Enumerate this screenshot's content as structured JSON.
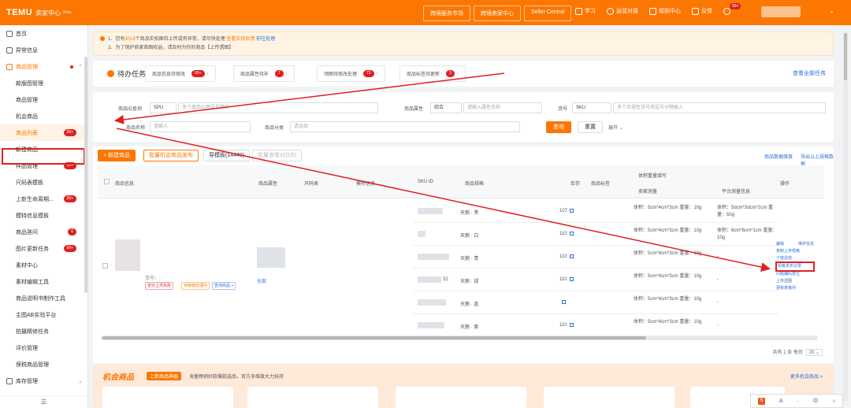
{
  "topbar": {
    "logo": "TEMU",
    "subtitle": "卖家中心",
    "beta": "Beta",
    "nav": [
      "跨境服务市场",
      "跨境卖家中心",
      "Seller Central"
    ],
    "icons": [
      {
        "label": "学习",
        "icon": "book-icon"
      },
      {
        "label": "运营对接",
        "icon": "chat-icon"
      },
      {
        "label": "规则中心",
        "icon": "rules-icon"
      },
      {
        "label": "反馈",
        "icon": "feedback-icon"
      },
      {
        "label": "",
        "icon": "bell-icon",
        "badge": "99+"
      }
    ],
    "accent": "#fb7701"
  },
  "sidebar": {
    "groups": [
      {
        "label": "首页",
        "icon": "home-icon"
      },
      {
        "label": "异常信息",
        "icon": "alert-icon"
      },
      {
        "label": "商品管理",
        "icon": "goods-icon",
        "active": true
      }
    ],
    "items": [
      {
        "label": "款版图管理"
      },
      {
        "label": "商品管理"
      },
      {
        "label": "机会商品"
      },
      {
        "label": "商品列表",
        "badge": "99+",
        "selected": true
      },
      {
        "label": "新建商品"
      },
      {
        "label": "样品管理",
        "badge": "99+"
      },
      {
        "label": "尺码表模板"
      },
      {
        "label": "上新生命周期...",
        "badge": "99+"
      },
      {
        "label": "模特信息模板"
      },
      {
        "label": "商品答问",
        "badge": "6"
      },
      {
        "label": "图片更新任务",
        "badge": "99+"
      },
      {
        "label": "素材中心"
      },
      {
        "label": "素材编辑工具"
      },
      {
        "label": "商品说明书制作工具"
      },
      {
        "label": "主图AB实验平台"
      },
      {
        "label": "拍摄精修任务"
      },
      {
        "label": "评价管理"
      },
      {
        "label": "保税商品管理"
      }
    ],
    "bottom_group": {
      "label": "库存管理",
      "icon": "warehouse-icon"
    },
    "footer": "☰"
  },
  "notice": {
    "line1_a": "1、您有",
    "line1_num": "3018",
    "line1_b": "个商品实拍图待上传或有异常，请尽快处理",
    "line1_link1": "查看实拍反馈",
    "line1_link2": "前往处理",
    "line2": "2、为了保护商家商图权益，请及时为你的商品【上传透图】"
  },
  "todo": {
    "title": "待办任务",
    "cards": [
      {
        "label": "商品信息待修改",
        "count": "99+"
      },
      {
        "label": "商品属性待补",
        "count": "7"
      },
      {
        "label": "领图待修改处理",
        "count": "73"
      },
      {
        "label": "商品标签待更新",
        "count": "3"
      }
    ],
    "all_link": "查看全部任务"
  },
  "filter": {
    "labels": [
      "商品ID查询",
      "商品属性",
      "货号",
      "商品名称",
      "商品分类"
    ],
    "spu_select": "SPU",
    "spu_placeholder": "多个商品ID用逗号隔开",
    "attr_select": "综合",
    "attr_placeholder": "请输入属性名称",
    "sku_select": "SKU",
    "sku_placeholder": "多个合规性货号用逗号分隔输入",
    "name_placeholder": "请输入",
    "cat_placeholder": "请选择",
    "query": "查询",
    "reset": "重置",
    "expand": "展开"
  },
  "toolbar": {
    "new": "+ 新建商品",
    "opp": "批量机会商品发布",
    "template": "导模板(14449)",
    "batch": "批量查看对比的",
    "link1": "商品数据维度",
    "link2": "导出以上规格数据"
  },
  "table": {
    "headers": {
      "info": "商品信息",
      "attr": "商品属性",
      "size": "尺码表",
      "model": "模特信息",
      "sku_id": "SKU ID",
      "spec": "商品规格",
      "stock": "库存",
      "label": "商品标签",
      "weight_group": "体积重量填写",
      "own": "卖家测量",
      "platform": "平台测量信息",
      "ops": "操作"
    },
    "product": {
      "status": "货号：-",
      "tags": [
        "定价上市失败",
        "待审核处理中",
        "查询商品 >"
      ],
      "attr_link": "全部"
    },
    "rows": [
      {
        "spec": "天鹅 · 黑",
        "stock": "107",
        "own": "体积：5cm*4cm*3cm  重量：10g",
        "platform": "体积：5dcm*3dcm*2cm  重量：50g"
      },
      {
        "spec": "天鹅 · 白",
        "stock": "110",
        "own": "体积：5cm*4cm*3cm  重量：10g",
        "platform": "体积：6cm*6cm*1cm  重量：10g"
      },
      {
        "spec": "天鹅 · 青",
        "stock": "110",
        "own": "体积：5cm*4cm*3cm  重量：10g",
        "platform": "-"
      },
      {
        "spec": "天鹅 · 绿",
        "stock": "110",
        "own": "体积：5cm*4cm*3cm  重量：10g",
        "platform": "-"
      },
      {
        "spec": "天鹅 · 蓝",
        "stock": "",
        "own": "体积：5cm*4cm*3cm  重量：10g",
        "platform": "-"
      },
      {
        "spec": "天鹅 · 紫",
        "stock": "110",
        "own": "体积：5cm*4cm*3cm  重量：10g",
        "platform": "-"
      }
    ],
    "row_sku_tail": [
      "",
      "",
      "",
      "32",
      "",
      ""
    ],
    "ops": [
      "编辑",
      "维护信息",
      "复制上传规格",
      "个度总结",
      "规格发布记录",
      "问题编码复位",
      "上传透图",
      "更新表格列"
    ],
    "ops_highlight": "规格发布记录"
  },
  "pager": {
    "total": "共有 1 条",
    "per": "每页",
    "size": "20"
  },
  "opportunity": {
    "title": "机会商品",
    "tag": "上新商品神器",
    "desc": "海量畅销好款爆款选品，官方多维度大力扶持",
    "more": "更多机会商品 >"
  },
  "ime": [
    "A",
    "·",
    "中",
    "♪"
  ]
}
